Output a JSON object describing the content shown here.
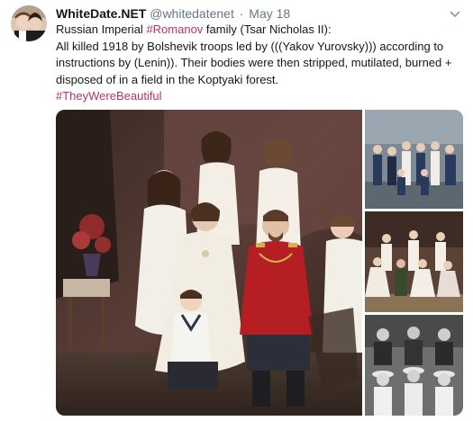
{
  "tweet": {
    "display_name": "WhiteDate.NET",
    "handle": "@whitedatenet",
    "separator": "·",
    "date": "May 18",
    "line1_pre": "Russian Imperial ",
    "line1_hashtag": "#Romanov",
    "line1_post": " family (Tsar Nicholas II):",
    "line2": "All killed 1918 by Bolshevik troops led by (((Yakov  Yurovsky))) according to",
    "line3": "instructions by (Lenin)). Their bodies were then stripped, mutilated, burned +",
    "line4": "disposed of in a field in the Koptyaki forest.",
    "line5_hashtag": "#TheyWereBeautiful"
  },
  "icons": {
    "caret": "chevron-down-icon"
  },
  "colors": {
    "hashtag": "#b8316f",
    "meta": "#657786",
    "text": "#14171a"
  }
}
